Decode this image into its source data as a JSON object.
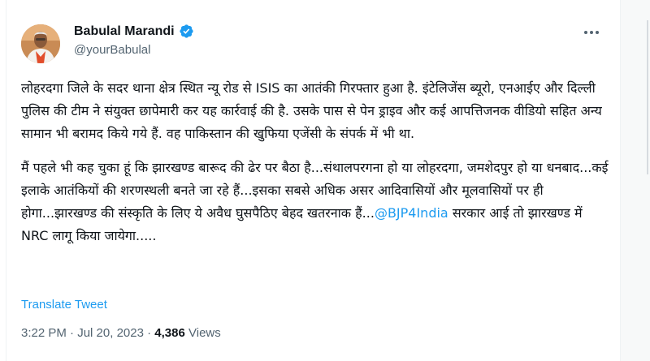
{
  "author": {
    "display_name": "Babulal Marandi",
    "handle": "@yourBabulal",
    "verified_icon": "verified-badge-icon",
    "avatar_icon": "profile-photo"
  },
  "menu": {
    "more_icon": "more-options-icon"
  },
  "tweet": {
    "para1": "लोहरदगा जिले के सदर थाना क्षेत्र स्थित न्यू रोड से ISIS का आतंकी गिरफ्तार हुआ है. इंटेलिजेंस ब्यूरो, एनआईए और दिल्ली पुलिस की टीम ने संयुक्त छापेमारी कर यह कार्रवाई की है. उसके पास से पेन ड्राइव और कई आपत्तिजनक वीडियो सहित अन्य सामान भी बरामद किये गये हैं. वह पाकिस्तान की खुफिया एजेंसी के संपर्क में भी था.",
    "para2_before": "मैं पहले भी कह चुका हूं कि झारखण्ड बारूद की ढेर पर बैठा है...संथालपरगना हो या लोहरदगा, जमशेदपुर हो या धनबाद...कई इलाके आतंकियों की शरणस्थली बनते जा रहे हैं...इसका सबसे अधिक असर आदिवासियों और मूलवासियों पर ही होगा...झारखण्ड की संस्कृति के लिए ये अवैध घुसपैठिए बेहद खतरनाक हैं...",
    "mention": "@BJP4India",
    "para2_after": " सरकार आई तो झारखण्ड में NRC लागू किया जायेगा....."
  },
  "translate_label": "Translate Tweet",
  "meta": {
    "time": "3:22 PM",
    "separator": " · ",
    "date": "Jul 20, 2023",
    "views_count": "4,386",
    "views_label": " Views"
  },
  "colors": {
    "text": "#0f1419",
    "secondary": "#536471",
    "link": "#1d9bf0",
    "verified": "#1d9bf0"
  }
}
